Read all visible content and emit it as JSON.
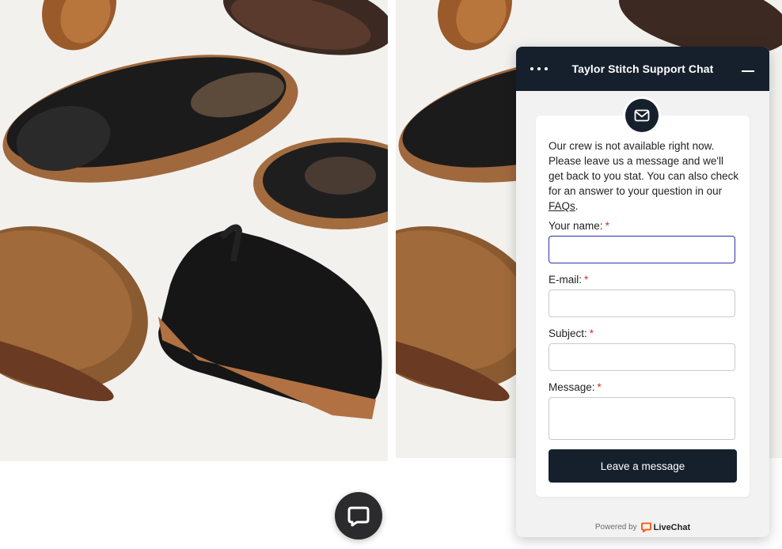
{
  "chat": {
    "title": "Taylor Stitch Support Chat",
    "offline_message_prefix": "Our crew is not available right now. Please leave us a message and we'll get back to you stat. You can also check for an answer to your question in our ",
    "faq_link": "FAQs",
    "offline_message_suffix": ".",
    "fields": {
      "name_label": "Your name:",
      "email_label": "E-mail:",
      "subject_label": "Subject:",
      "message_label": "Message:",
      "required_marker": "*"
    },
    "submit_label": "Leave a message",
    "powered_by_label": "Powered by",
    "brand_name": "LiveChat"
  },
  "icons": {
    "menu": "more-dots-icon",
    "minimize": "minimize-icon",
    "mail": "mail-icon",
    "launcher": "chat-bubble-icon",
    "brand": "livechat-logo-icon"
  },
  "colors": {
    "header": "#16202d",
    "accent_focus": "#2a2fb0",
    "required": "#d12e2e",
    "brand": "#ff5100"
  }
}
